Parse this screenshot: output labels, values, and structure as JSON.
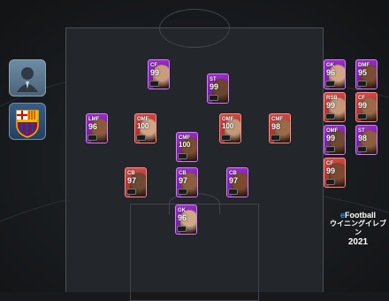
{
  "logo": {
    "line1_prefix": "e",
    "line1_rest": "Football",
    "line2": "ウイニングイレブン",
    "line3": "2021"
  },
  "formation": [
    {
      "pos": "CF",
      "rating": "99",
      "theme": "purple"
    },
    {
      "pos": "ST",
      "rating": "99",
      "theme": "purple"
    },
    {
      "pos": "LMF",
      "rating": "96",
      "theme": "purple"
    },
    {
      "pos": "OMF",
      "rating": "100",
      "theme": "red"
    },
    {
      "pos": "CMF",
      "rating": "100",
      "theme": "purple"
    },
    {
      "pos": "OMF",
      "rating": "100",
      "theme": "red"
    },
    {
      "pos": "CMF",
      "rating": "98",
      "theme": "red"
    },
    {
      "pos": "CB",
      "rating": "97",
      "theme": "red"
    },
    {
      "pos": "CB",
      "rating": "97",
      "theme": "purple"
    },
    {
      "pos": "CB",
      "rating": "97",
      "theme": "purple"
    },
    {
      "pos": "GK",
      "rating": "96",
      "theme": "purple"
    }
  ],
  "bench": [
    {
      "pos": "GK",
      "rating": "96",
      "theme": "purple"
    },
    {
      "pos": "DMF",
      "rating": "95",
      "theme": "purple"
    },
    {
      "pos": "RSB",
      "rating": "99",
      "theme": "red"
    },
    {
      "pos": "CF",
      "rating": "99",
      "theme": "red"
    },
    {
      "pos": "OMF",
      "rating": "99",
      "theme": "purple"
    },
    {
      "pos": "ST",
      "rating": "98",
      "theme": "purple"
    },
    {
      "pos": "CF",
      "rating": "99",
      "theme": "red"
    }
  ]
}
